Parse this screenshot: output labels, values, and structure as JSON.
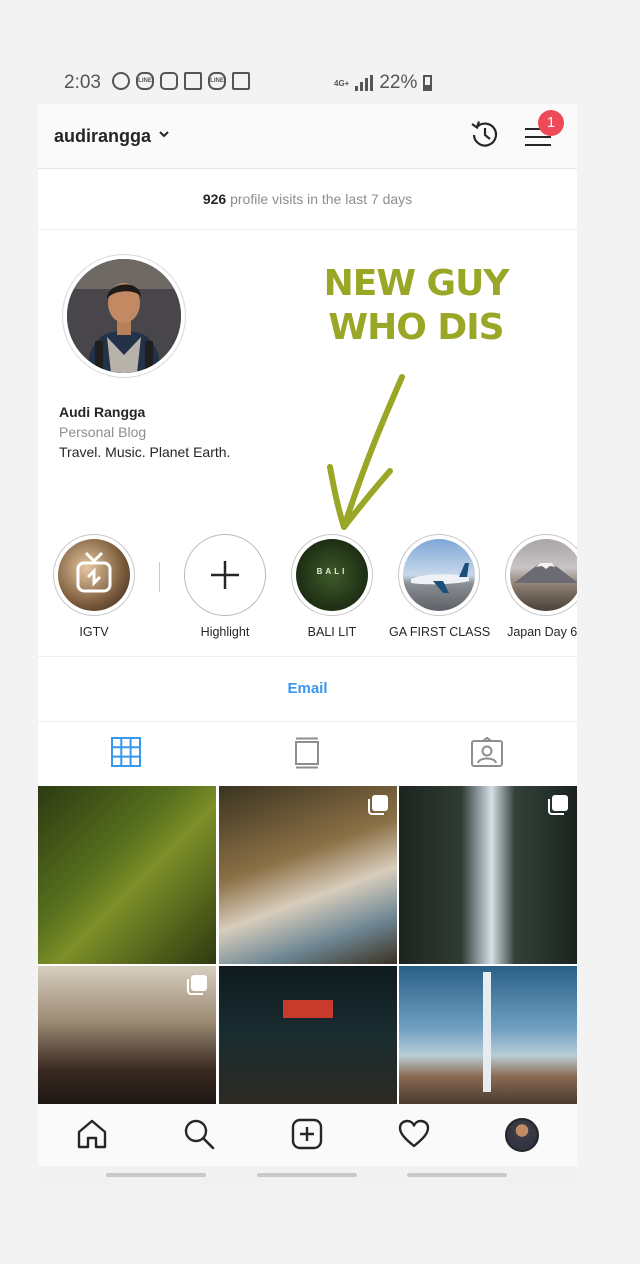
{
  "status_bar": {
    "time": "2:03",
    "network": "4G+",
    "battery": "22%",
    "notification_icons": [
      "whatsapp-icon",
      "line-icon",
      "instagram-icon",
      "mail-open-icon",
      "line-icon",
      "gmail-icon"
    ]
  },
  "header": {
    "username": "audirangga",
    "notification_count": "1"
  },
  "insights": {
    "count": "926",
    "text": "profile visits in the last 7 days"
  },
  "annotation": {
    "line1": "NEW GUY",
    "line2": "WHO DIS",
    "color": "#9aa625"
  },
  "profile": {
    "name": "Audi Rangga",
    "category": "Personal Blog",
    "bio": "Travel. Music. Planet Earth."
  },
  "highlights": [
    {
      "label": "IGTV"
    },
    {
      "label": "Highlight"
    },
    {
      "label": "BALI LIT",
      "cover_text": "BALI"
    },
    {
      "label": "GA FIRST CLASS"
    },
    {
      "label": "Japan Day 6 -"
    }
  ],
  "contact": {
    "email_label": "Email"
  },
  "colors": {
    "accent": "#3897f0",
    "badge": "#ed4956"
  }
}
